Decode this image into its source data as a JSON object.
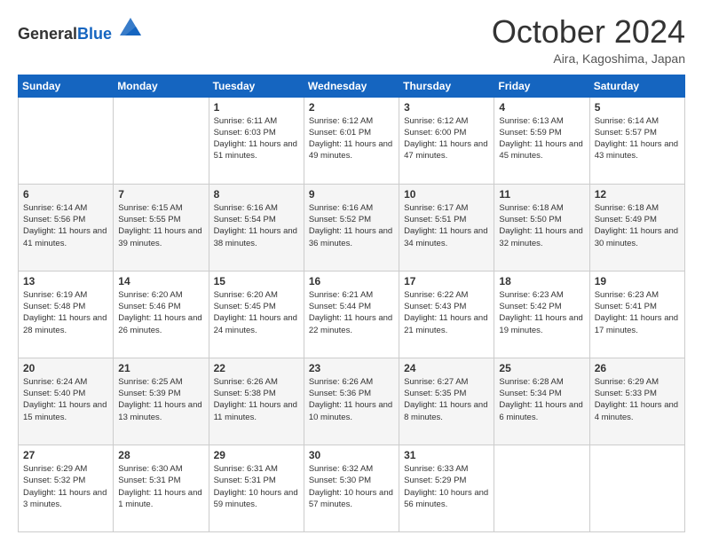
{
  "header": {
    "logo_general": "General",
    "logo_blue": "Blue",
    "month": "October 2024",
    "location": "Aira, Kagoshima, Japan"
  },
  "weekdays": [
    "Sunday",
    "Monday",
    "Tuesday",
    "Wednesday",
    "Thursday",
    "Friday",
    "Saturday"
  ],
  "weeks": [
    [
      {
        "day": "",
        "sunrise": "",
        "sunset": "",
        "daylight": ""
      },
      {
        "day": "",
        "sunrise": "",
        "sunset": "",
        "daylight": ""
      },
      {
        "day": "1",
        "sunrise": "Sunrise: 6:11 AM",
        "sunset": "Sunset: 6:03 PM",
        "daylight": "Daylight: 11 hours and 51 minutes."
      },
      {
        "day": "2",
        "sunrise": "Sunrise: 6:12 AM",
        "sunset": "Sunset: 6:01 PM",
        "daylight": "Daylight: 11 hours and 49 minutes."
      },
      {
        "day": "3",
        "sunrise": "Sunrise: 6:12 AM",
        "sunset": "Sunset: 6:00 PM",
        "daylight": "Daylight: 11 hours and 47 minutes."
      },
      {
        "day": "4",
        "sunrise": "Sunrise: 6:13 AM",
        "sunset": "Sunset: 5:59 PM",
        "daylight": "Daylight: 11 hours and 45 minutes."
      },
      {
        "day": "5",
        "sunrise": "Sunrise: 6:14 AM",
        "sunset": "Sunset: 5:57 PM",
        "daylight": "Daylight: 11 hours and 43 minutes."
      }
    ],
    [
      {
        "day": "6",
        "sunrise": "Sunrise: 6:14 AM",
        "sunset": "Sunset: 5:56 PM",
        "daylight": "Daylight: 11 hours and 41 minutes."
      },
      {
        "day": "7",
        "sunrise": "Sunrise: 6:15 AM",
        "sunset": "Sunset: 5:55 PM",
        "daylight": "Daylight: 11 hours and 39 minutes."
      },
      {
        "day": "8",
        "sunrise": "Sunrise: 6:16 AM",
        "sunset": "Sunset: 5:54 PM",
        "daylight": "Daylight: 11 hours and 38 minutes."
      },
      {
        "day": "9",
        "sunrise": "Sunrise: 6:16 AM",
        "sunset": "Sunset: 5:52 PM",
        "daylight": "Daylight: 11 hours and 36 minutes."
      },
      {
        "day": "10",
        "sunrise": "Sunrise: 6:17 AM",
        "sunset": "Sunset: 5:51 PM",
        "daylight": "Daylight: 11 hours and 34 minutes."
      },
      {
        "day": "11",
        "sunrise": "Sunrise: 6:18 AM",
        "sunset": "Sunset: 5:50 PM",
        "daylight": "Daylight: 11 hours and 32 minutes."
      },
      {
        "day": "12",
        "sunrise": "Sunrise: 6:18 AM",
        "sunset": "Sunset: 5:49 PM",
        "daylight": "Daylight: 11 hours and 30 minutes."
      }
    ],
    [
      {
        "day": "13",
        "sunrise": "Sunrise: 6:19 AM",
        "sunset": "Sunset: 5:48 PM",
        "daylight": "Daylight: 11 hours and 28 minutes."
      },
      {
        "day": "14",
        "sunrise": "Sunrise: 6:20 AM",
        "sunset": "Sunset: 5:46 PM",
        "daylight": "Daylight: 11 hours and 26 minutes."
      },
      {
        "day": "15",
        "sunrise": "Sunrise: 6:20 AM",
        "sunset": "Sunset: 5:45 PM",
        "daylight": "Daylight: 11 hours and 24 minutes."
      },
      {
        "day": "16",
        "sunrise": "Sunrise: 6:21 AM",
        "sunset": "Sunset: 5:44 PM",
        "daylight": "Daylight: 11 hours and 22 minutes."
      },
      {
        "day": "17",
        "sunrise": "Sunrise: 6:22 AM",
        "sunset": "Sunset: 5:43 PM",
        "daylight": "Daylight: 11 hours and 21 minutes."
      },
      {
        "day": "18",
        "sunrise": "Sunrise: 6:23 AM",
        "sunset": "Sunset: 5:42 PM",
        "daylight": "Daylight: 11 hours and 19 minutes."
      },
      {
        "day": "19",
        "sunrise": "Sunrise: 6:23 AM",
        "sunset": "Sunset: 5:41 PM",
        "daylight": "Daylight: 11 hours and 17 minutes."
      }
    ],
    [
      {
        "day": "20",
        "sunrise": "Sunrise: 6:24 AM",
        "sunset": "Sunset: 5:40 PM",
        "daylight": "Daylight: 11 hours and 15 minutes."
      },
      {
        "day": "21",
        "sunrise": "Sunrise: 6:25 AM",
        "sunset": "Sunset: 5:39 PM",
        "daylight": "Daylight: 11 hours and 13 minutes."
      },
      {
        "day": "22",
        "sunrise": "Sunrise: 6:26 AM",
        "sunset": "Sunset: 5:38 PM",
        "daylight": "Daylight: 11 hours and 11 minutes."
      },
      {
        "day": "23",
        "sunrise": "Sunrise: 6:26 AM",
        "sunset": "Sunset: 5:36 PM",
        "daylight": "Daylight: 11 hours and 10 minutes."
      },
      {
        "day": "24",
        "sunrise": "Sunrise: 6:27 AM",
        "sunset": "Sunset: 5:35 PM",
        "daylight": "Daylight: 11 hours and 8 minutes."
      },
      {
        "day": "25",
        "sunrise": "Sunrise: 6:28 AM",
        "sunset": "Sunset: 5:34 PM",
        "daylight": "Daylight: 11 hours and 6 minutes."
      },
      {
        "day": "26",
        "sunrise": "Sunrise: 6:29 AM",
        "sunset": "Sunset: 5:33 PM",
        "daylight": "Daylight: 11 hours and 4 minutes."
      }
    ],
    [
      {
        "day": "27",
        "sunrise": "Sunrise: 6:29 AM",
        "sunset": "Sunset: 5:32 PM",
        "daylight": "Daylight: 11 hours and 3 minutes."
      },
      {
        "day": "28",
        "sunrise": "Sunrise: 6:30 AM",
        "sunset": "Sunset: 5:31 PM",
        "daylight": "Daylight: 11 hours and 1 minute."
      },
      {
        "day": "29",
        "sunrise": "Sunrise: 6:31 AM",
        "sunset": "Sunset: 5:31 PM",
        "daylight": "Daylight: 10 hours and 59 minutes."
      },
      {
        "day": "30",
        "sunrise": "Sunrise: 6:32 AM",
        "sunset": "Sunset: 5:30 PM",
        "daylight": "Daylight: 10 hours and 57 minutes."
      },
      {
        "day": "31",
        "sunrise": "Sunrise: 6:33 AM",
        "sunset": "Sunset: 5:29 PM",
        "daylight": "Daylight: 10 hours and 56 minutes."
      },
      {
        "day": "",
        "sunrise": "",
        "sunset": "",
        "daylight": ""
      },
      {
        "day": "",
        "sunrise": "",
        "sunset": "",
        "daylight": ""
      }
    ]
  ]
}
